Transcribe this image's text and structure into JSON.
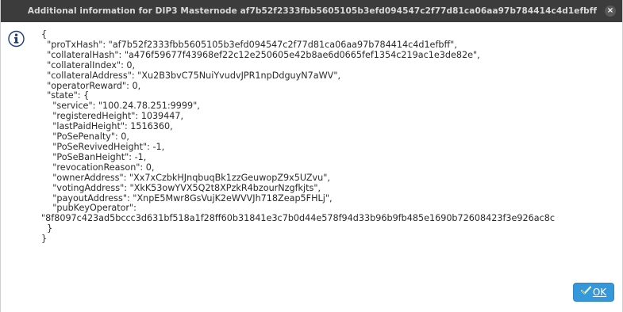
{
  "window": {
    "title": "Additional information for DIP3 Masternode af7b52f2333fbb5605105b3efd094547c2f77d81ca06aa97b784414c4d1efbff",
    "close_glyph": "×"
  },
  "icons": {
    "info": "info-icon",
    "close": "close-icon",
    "ok": "checkmark-icon"
  },
  "json_lines": [
    "{",
    "  \"proTxHash\": \"af7b52f2333fbb5605105b3efd094547c2f77d81ca06aa97b784414c4d1efbff\",",
    "  \"collateralHash\": \"a476f59677f43968ef22c12e250605e42b8ae6d0665fef1354c219ac1e3de82e\",",
    "  \"collateralIndex\": 0,",
    "  \"collateralAddress\": \"Xu2B3bvC75NuiYvudvJPR1npDdguyN7aWV\",",
    "  \"operatorReward\": 0,",
    "  \"state\": {",
    "    \"service\": \"100.24.78.251:9999\",",
    "    \"registeredHeight\": 1039447,",
    "    \"lastPaidHeight\": 1516360,",
    "    \"PoSePenalty\": 0,",
    "    \"PoSeRevivedHeight\": -1,",
    "    \"PoSeBanHeight\": -1,",
    "    \"revocationReason\": 0,",
    "    \"ownerAddress\": \"Xx7xCzbkHJnqbuqBk1zzGeuwopZ9x5UZvu\",",
    "    \"votingAddress\": \"XkK53owYVX5Q2t8XPzkR4bzourNzgfkjts\",",
    "    \"payoutAddress\": \"XnpE5Mwr8GsVujK2eWVVJh718Zeap5FHLj\",",
    "    \"pubKeyOperator\":",
    "\"8f8097c423ad5bccc3d631bf518a1f28ff60b31841e3c7b0d44e578f94d33b96b9fb485e1690b72608423f3e926ac8c",
    "  }",
    "}"
  ],
  "buttons": {
    "ok_label": "OK"
  },
  "colors": {
    "titlebar_bg": "#3c3c3c",
    "ok_button_bg": "#3498db",
    "info_icon_fill": "#1a3a8a"
  }
}
